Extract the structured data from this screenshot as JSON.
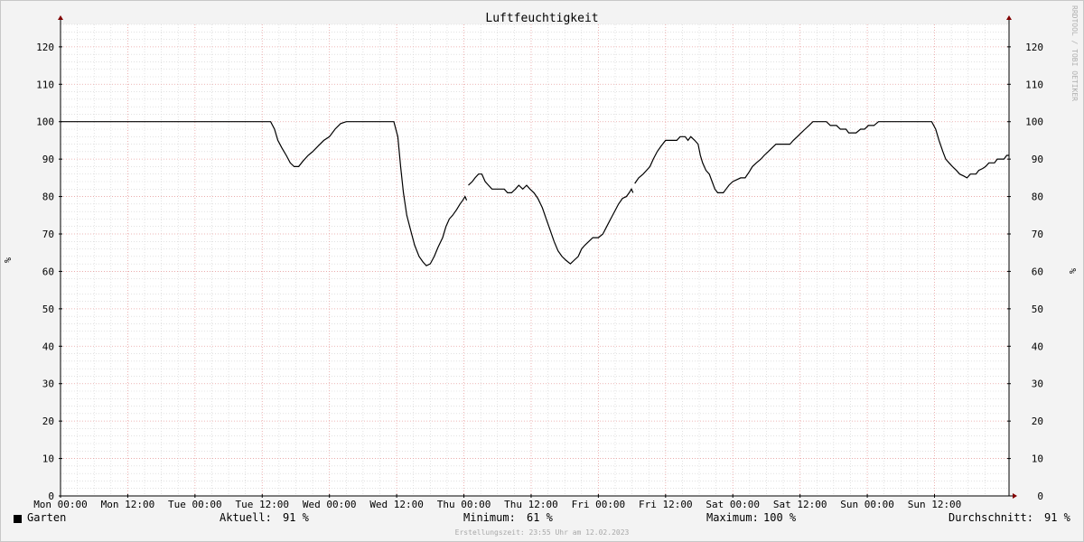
{
  "chart_data": {
    "type": "line",
    "title": "Luftfeuchtigkeit",
    "ylabel": "%",
    "xlabel": "",
    "ylim": [
      0,
      126
    ],
    "xlim": [
      0,
      168
    ],
    "yticks": [
      0,
      10,
      20,
      30,
      40,
      50,
      60,
      70,
      80,
      90,
      100,
      110,
      120
    ],
    "xtick_labels": [
      "Mon 00:00",
      "Mon 12:00",
      "Tue 00:00",
      "Tue 12:00",
      "Wed 00:00",
      "Wed 12:00",
      "Thu 00:00",
      "Thu 12:00",
      "Fri 00:00",
      "Fri 12:00",
      "Sat 00:00",
      "Sat 12:00",
      "Sun 00:00",
      "Sun 12:00"
    ],
    "xticks_hours": [
      0,
      12,
      24,
      36,
      48,
      60,
      72,
      84,
      96,
      108,
      120,
      132,
      144,
      156
    ],
    "x_unit": "hours since Mon 00:00",
    "grid": true,
    "series": [
      {
        "name": "Garten",
        "color": "#000000",
        "segments": [
          [
            [
              0,
              100
            ],
            [
              10,
              100
            ],
            [
              20,
              100
            ],
            [
              30,
              100
            ],
            [
              37.5,
              100
            ],
            [
              38.2,
              98
            ],
            [
              38.8,
              95
            ],
            [
              39.5,
              93
            ],
            [
              40.3,
              91
            ],
            [
              41,
              89
            ],
            [
              41.7,
              88
            ],
            [
              42.5,
              88
            ],
            [
              43.3,
              89.5
            ],
            [
              44.2,
              91
            ],
            [
              45,
              92
            ],
            [
              46,
              93.5
            ],
            [
              47,
              95
            ],
            [
              48,
              96
            ],
            [
              49,
              98
            ],
            [
              50,
              99.5
            ],
            [
              51,
              100
            ],
            [
              54,
              100
            ],
            [
              58,
              100
            ],
            [
              59.5,
              100
            ],
            [
              60.2,
              96
            ],
            [
              60.7,
              88
            ],
            [
              61.2,
              81
            ],
            [
              61.8,
              75
            ],
            [
              62.5,
              71
            ],
            [
              63.2,
              67
            ],
            [
              64,
              64
            ],
            [
              64.7,
              62.5
            ],
            [
              65.3,
              61.5
            ],
            [
              66,
              62
            ],
            [
              66.7,
              64
            ],
            [
              67.4,
              66.5
            ],
            [
              68.2,
              69
            ],
            [
              68.8,
              72
            ],
            [
              69.4,
              74
            ],
            [
              70,
              75
            ],
            [
              70.7,
              76.5
            ],
            [
              71.3,
              78
            ],
            [
              71.8,
              79
            ],
            [
              72.2,
              80
            ],
            [
              72.5,
              79
            ]
          ],
          [
            [
              72.8,
              83
            ],
            [
              73.5,
              84
            ],
            [
              74,
              85
            ],
            [
              74.6,
              86
            ],
            [
              75.2,
              86
            ],
            [
              75.8,
              84
            ],
            [
              76.4,
              83
            ],
            [
              77,
              82
            ],
            [
              78,
              82
            ],
            [
              79.2,
              82
            ],
            [
              79.8,
              81
            ],
            [
              80.5,
              81
            ],
            [
              81.2,
              82
            ],
            [
              81.8,
              83
            ],
            [
              82.5,
              82
            ],
            [
              83.2,
              83
            ],
            [
              83.8,
              82
            ],
            [
              84.5,
              81
            ],
            [
              85.2,
              79.5
            ],
            [
              86,
              77
            ],
            [
              86.7,
              74
            ],
            [
              87.4,
              71
            ],
            [
              88.1,
              68
            ],
            [
              88.8,
              65.5
            ],
            [
              89.5,
              64
            ],
            [
              90.2,
              63
            ],
            [
              91,
              62
            ],
            [
              91.7,
              63
            ],
            [
              92.4,
              64
            ],
            [
              93,
              66
            ],
            [
              93.6,
              67
            ],
            [
              94.3,
              68
            ],
            [
              95,
              69
            ],
            [
              96,
              69
            ],
            [
              96.8,
              70
            ],
            [
              97.5,
              72
            ],
            [
              98.2,
              74
            ],
            [
              98.9,
              76
            ],
            [
              99.6,
              78
            ],
            [
              100.3,
              79.5
            ],
            [
              101,
              80
            ],
            [
              101.5,
              81
            ],
            [
              101.9,
              82
            ],
            [
              102.2,
              81
            ]
          ],
          [
            [
              102.5,
              83.5
            ],
            [
              103.2,
              85
            ],
            [
              104,
              86
            ],
            [
              104.6,
              87
            ],
            [
              105.2,
              88
            ],
            [
              105.8,
              90
            ],
            [
              106.5,
              92
            ],
            [
              107.2,
              93.5
            ],
            [
              108,
              95
            ],
            [
              109,
              95
            ],
            [
              110,
              95
            ],
            [
              110.6,
              96
            ],
            [
              111.5,
              96
            ],
            [
              112,
              95
            ],
            [
              112.5,
              96
            ],
            [
              113.2,
              95
            ],
            [
              113.8,
              94
            ],
            [
              114.2,
              91
            ],
            [
              114.6,
              89
            ],
            [
              115.2,
              87
            ],
            [
              115.8,
              86
            ],
            [
              116.3,
              84
            ],
            [
              116.8,
              82
            ],
            [
              117.3,
              81
            ],
            [
              118.3,
              81
            ],
            [
              118.8,
              82
            ],
            [
              119.3,
              83
            ],
            [
              120,
              84
            ],
            [
              120.7,
              84.5
            ],
            [
              121.4,
              85
            ],
            [
              122.2,
              85
            ],
            [
              122.9,
              86.5
            ],
            [
              123.5,
              88
            ],
            [
              124.2,
              89
            ],
            [
              125,
              90
            ],
            [
              125.6,
              91
            ],
            [
              126.3,
              92
            ],
            [
              127,
              93
            ],
            [
              127.7,
              94
            ],
            [
              128.5,
              94
            ],
            [
              129.5,
              94
            ],
            [
              130.2,
              94
            ],
            [
              130.8,
              95
            ],
            [
              131.5,
              96
            ],
            [
              132.2,
              97
            ],
            [
              132.9,
              98
            ],
            [
              133.6,
              99
            ],
            [
              134.3,
              100
            ],
            [
              135.5,
              100
            ],
            [
              136.7,
              100
            ],
            [
              137.4,
              99
            ],
            [
              138.5,
              99
            ],
            [
              139.2,
              98
            ],
            [
              140.2,
              98
            ],
            [
              140.7,
              97
            ],
            [
              142,
              97
            ],
            [
              142.8,
              98
            ],
            [
              143.5,
              98
            ],
            [
              144.2,
              99
            ],
            [
              145.2,
              99
            ],
            [
              146,
              100
            ],
            [
              150,
              100
            ],
            [
              154,
              100
            ],
            [
              155.5,
              100
            ],
            [
              156.2,
              98
            ],
            [
              156.8,
              95
            ],
            [
              157.5,
              92
            ],
            [
              158,
              90
            ],
            [
              158.6,
              89
            ],
            [
              159.2,
              88
            ],
            [
              159.9,
              87
            ],
            [
              160.5,
              86
            ],
            [
              161.2,
              85.5
            ],
            [
              161.8,
              85
            ],
            [
              162.4,
              86
            ],
            [
              163.4,
              86
            ],
            [
              163.9,
              87
            ],
            [
              164.6,
              87.5
            ],
            [
              165.1,
              88
            ],
            [
              165.7,
              89
            ],
            [
              166.7,
              89
            ],
            [
              167.2,
              90
            ],
            [
              168.4,
              90
            ],
            [
              168.9,
              91
            ],
            [
              169.3,
              91
            ]
          ]
        ]
      }
    ]
  },
  "legend": {
    "series_label": "Garten",
    "current_label": "Aktuell:",
    "current_value": "91 %",
    "min_label": "Minimum:",
    "min_value": "61 %",
    "max_label": "Maximum:",
    "max_value": "100 %",
    "avg_label": "Durchschnitt:",
    "avg_value": "91 %"
  },
  "footer": "Erstellungszeit: 23:55 Uhr am 12.02.2023",
  "watermark": "RRDTOOL / TOBI OETIKER",
  "colors": {
    "background": "#f3f3f3",
    "plot_bg": "#ffffff",
    "major_grid": "#e8a0a0",
    "minor_grid": "#d0d0d0",
    "axis": "#000000",
    "arrow": "#800000",
    "line": "#000000"
  }
}
